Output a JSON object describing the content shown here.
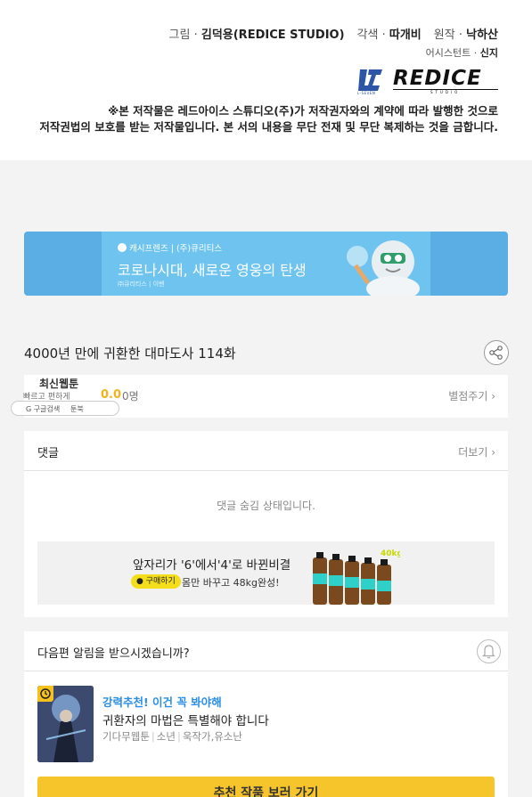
{
  "credits": {
    "art_label": "그림",
    "art_name": "김덕용(REDICE STUDIO)",
    "adapt_label": "각색",
    "adapt_name": "따개비",
    "original_label": "원작",
    "original_name": "낙하산",
    "assistant_label": "어시스턴트",
    "assistant_name": "신지",
    "logo_l7_text": "L7",
    "logo_l7_sub": "L-SEVEN",
    "logo_redice_text": "REDICE",
    "logo_redice_sub": "STUDIO",
    "notice_line1": "※본 저작물은 레드아이스 스튜디오(주)가 저작권자와의 계약에 따라 발행한 것으로",
    "notice_line2": "저작권법의 보호를 받는 저작물입니다. 본 서의 내용을 무단 전재 및 무단 복제하는 것을 금합니다."
  },
  "banner": {
    "brand": "캐시프렌즈 | (주)큐리티스",
    "title": "코로나시대, 새로운 영웅의 탄생",
    "sub": "㈜큐리티스 | 이벤",
    "bg_color": "#5aaee4"
  },
  "episode": {
    "title": "4000년 만에 귀환한 대마도사 114화",
    "rating_score": "0.0",
    "rating_count": "0명",
    "rate_link": "별점주기 ›"
  },
  "overlay": {
    "title": "최신웹툰",
    "sub": "빠르고 편하게",
    "pill_left": "G 구글검색",
    "pill_right": "툰북"
  },
  "comments": {
    "title": "댓글",
    "more": "더보기 ›",
    "hidden_text": "댓글 숨김 상태입니다.",
    "ad_title": "앞자리가 '6'에서'4'로 바뀐비결",
    "ad_button": "구매하기",
    "ad_desc": "몸만 바꾸고 48kg완성!",
    "ad_badge": "40kg"
  },
  "notify": {
    "title": "다음편 알림을 받으시겠습니까?",
    "rec_promo": "강력추천! 이건 꼭 봐야해",
    "rec_title": "귀환자의 마법은 특별해야 합니다",
    "rec_genre": "기다무웹툰",
    "rec_tag": "소년",
    "rec_authors": "욱작가,유소난",
    "cta": "추천 작품 보러 가기"
  },
  "icons": {
    "share": "share-icon",
    "bell": "bell-icon",
    "clock": "clock-icon"
  },
  "colors": {
    "accent_yellow": "#f6c52b",
    "promo_blue": "#2b8ee6",
    "rating_gold": "#f2b21b"
  }
}
